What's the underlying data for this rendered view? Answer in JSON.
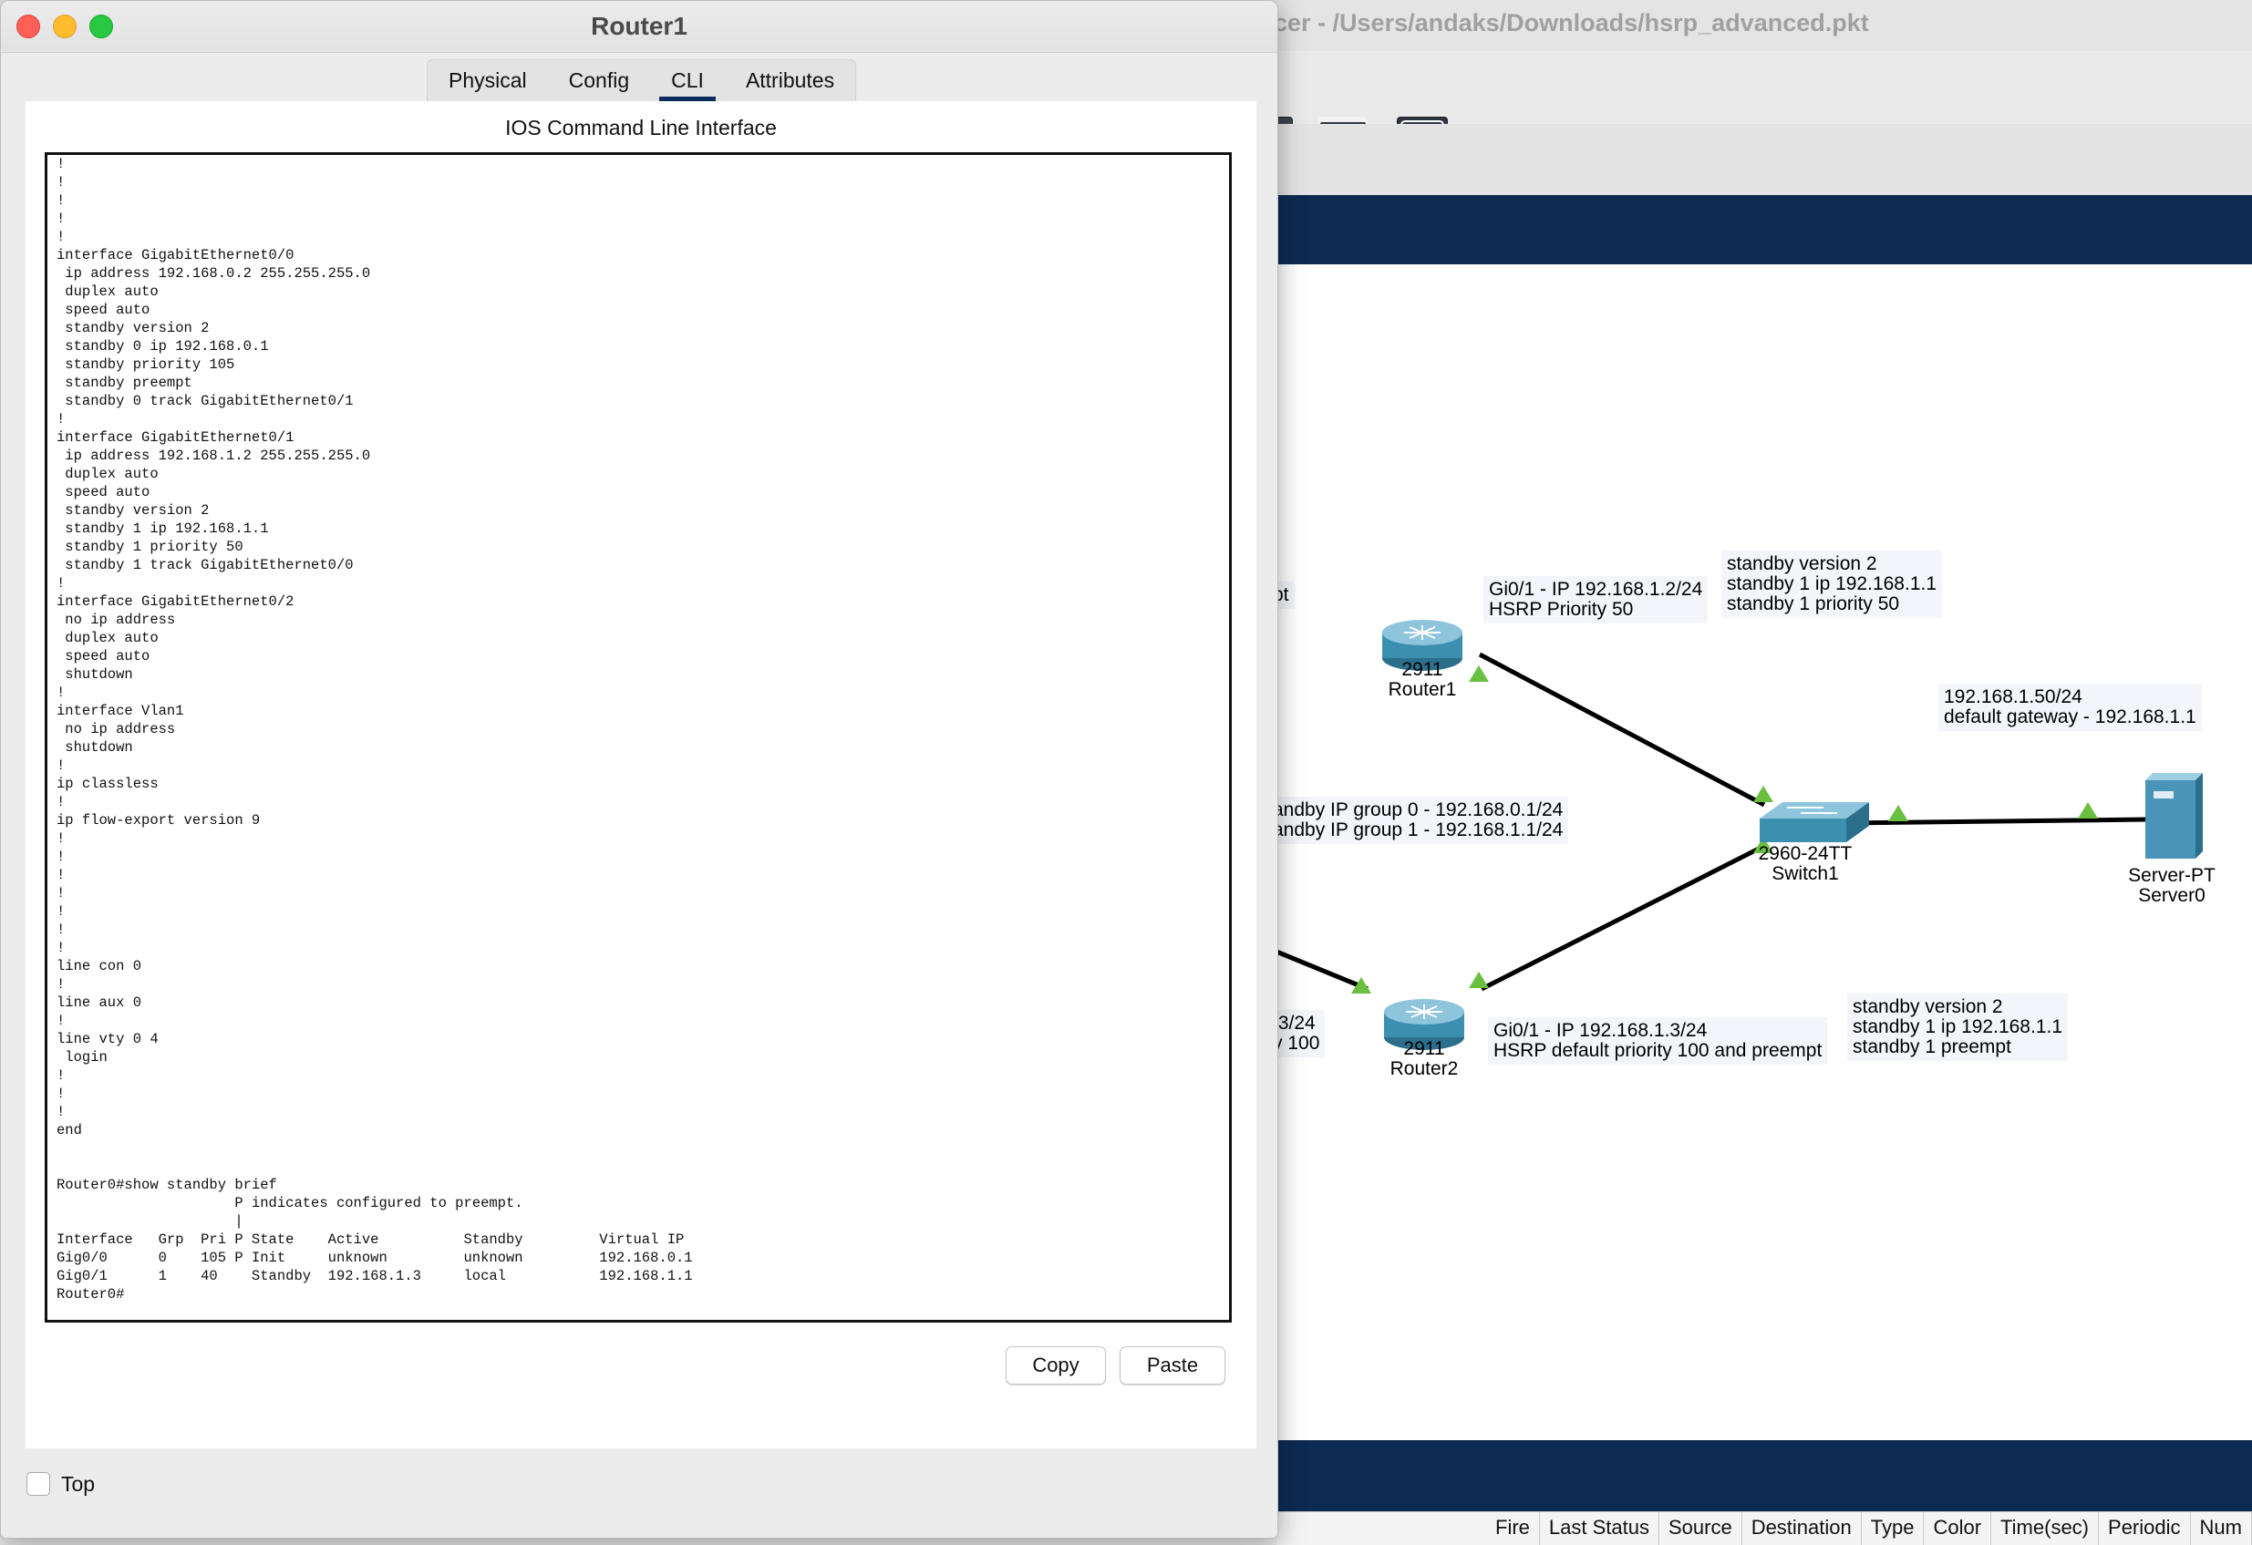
{
  "background_window": {
    "title": "cer - /Users/andaks/Downloads/hsrp_advanced.pkt",
    "toolbar_icons": [
      "device-icon",
      "server-rack-icon",
      "cloud-icon"
    ],
    "pdu_columns": [
      "Fire",
      "Last Status",
      "Source",
      "Destination",
      "Type",
      "Color",
      "Time(sec)",
      "Periodic",
      "Num"
    ]
  },
  "topology": {
    "notes": {
      "partial_left_top": "pt",
      "router1_ip": "Gi0/1 - IP 192.168.1.2/24\nHSRP Priority 50",
      "router1_cfg": "standby version 2\nstandby 1 ip 192.168.1.1\nstandby 1 priority 50",
      "server_ip": "192.168.1.50/24\ndefault gateway - 192.168.1.1",
      "standby_groups": "andby IP group 0 - 192.168.0.1/24\nandby IP group 1 - 192.168.1.1/24",
      "partial_left_bottom": ".3/24\ny 100",
      "router2_ip": "Gi0/1 - IP 192.168.1.3/24\nHSRP default priority 100 and preempt",
      "router2_cfg": "standby version 2\nstandby 1 ip 192.168.1.1\nstandby 1 preempt"
    },
    "devices": {
      "router1": {
        "model": "2911",
        "name": "Router1"
      },
      "router2": {
        "model": "2911",
        "name": "Router2"
      },
      "switch1": {
        "model": "2960-24TT",
        "name": "Switch1"
      },
      "server0": {
        "model": "Server-PT",
        "name": "Server0"
      }
    },
    "colors": {
      "link": "#000000",
      "link_up": "#6abf40",
      "router": "#3d8fb0",
      "server": "#4a94b8",
      "navy": "#0d2a52"
    }
  },
  "dialog": {
    "title": "Router1",
    "tabs": [
      {
        "label": "Physical",
        "active": false
      },
      {
        "label": "Config",
        "active": false
      },
      {
        "label": "CLI",
        "active": true
      },
      {
        "label": "Attributes",
        "active": false
      }
    ],
    "heading": "IOS Command Line Interface",
    "copy_label": "Copy",
    "paste_label": "Paste",
    "top_label": "Top",
    "cli_lines": [
      "!",
      "!",
      "!",
      "!",
      "!",
      "interface GigabitEthernet0/0",
      " ip address 192.168.0.2 255.255.255.0",
      " duplex auto",
      " speed auto",
      " standby version 2",
      " standby 0 ip 192.168.0.1",
      " standby priority 105",
      " standby preempt",
      " standby 0 track GigabitEthernet0/1",
      "!",
      "interface GigabitEthernet0/1",
      " ip address 192.168.1.2 255.255.255.0",
      " duplex auto",
      " speed auto",
      " standby version 2",
      " standby 1 ip 192.168.1.1",
      " standby 1 priority 50",
      " standby 1 track GigabitEthernet0/0",
      "!",
      "interface GigabitEthernet0/2",
      " no ip address",
      " duplex auto",
      " speed auto",
      " shutdown",
      "!",
      "interface Vlan1",
      " no ip address",
      " shutdown",
      "!",
      "ip classless",
      "!",
      "ip flow-export version 9",
      "!",
      "!",
      "!",
      "!",
      "!",
      "!",
      "!",
      "line con 0",
      "!",
      "line aux 0",
      "!",
      "line vty 0 4",
      " login",
      "!",
      "!",
      "!",
      "end",
      "",
      "",
      "Router0#show standby brief",
      "                     P indicates configured to preempt.",
      "                     |",
      "Interface   Grp  Pri P State    Active          Standby         Virtual IP",
      "Gig0/0      0    105 P Init     unknown         unknown         192.168.0.1",
      "Gig0/1      1    40    Standby  192.168.1.3     local           192.168.1.1",
      "Router0#"
    ]
  }
}
